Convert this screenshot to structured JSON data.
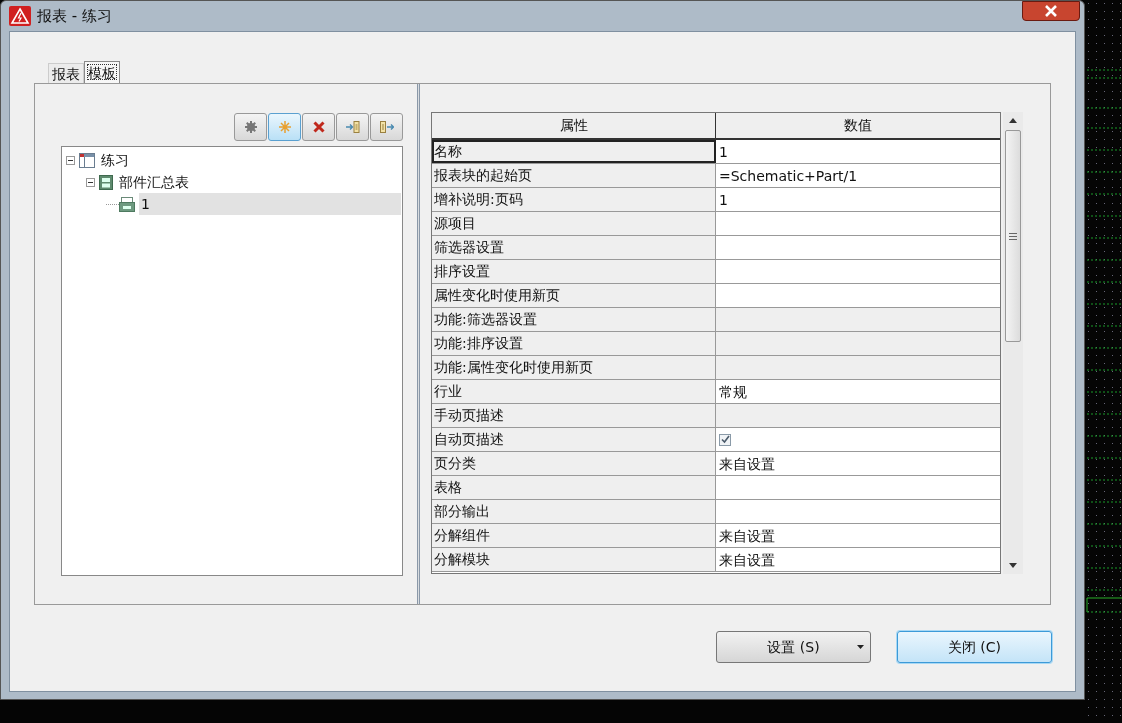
{
  "window": {
    "title": "报表 - 练习"
  },
  "tabs": [
    {
      "label": "报表",
      "selected": false
    },
    {
      "label": "模板",
      "selected": true
    }
  ],
  "toolbar": [
    {
      "kind": "settings",
      "highlighted": false
    },
    {
      "kind": "new",
      "highlighted": true
    },
    {
      "kind": "delete",
      "highlighted": false
    },
    {
      "kind": "import",
      "highlighted": false
    },
    {
      "kind": "export",
      "highlighted": false
    }
  ],
  "tree": [
    {
      "label": "练习",
      "kind": "project",
      "expanded": true,
      "selected": false,
      "children": [
        {
          "label": "部件汇总表",
          "kind": "report",
          "expanded": true,
          "selected": false,
          "children": [
            {
              "label": "1",
              "kind": "template",
              "selected": true
            }
          ]
        }
      ]
    }
  ],
  "grid": {
    "columns": [
      "属性",
      "数值"
    ],
    "rows": [
      {
        "name": "名称",
        "value": "1",
        "kind": "text",
        "editable": true,
        "selected": true
      },
      {
        "name": "报表块的起始页",
        "value": "=Schematic+Part/1",
        "kind": "text",
        "editable": true,
        "selected": false
      },
      {
        "name": "增补说明:页码",
        "value": "1",
        "kind": "text",
        "editable": true,
        "selected": false
      },
      {
        "name": "源项目",
        "kind": "text",
        "editable": true,
        "selected": false
      },
      {
        "name": "筛选器设置",
        "kind": "text",
        "editable": true,
        "selected": false
      },
      {
        "name": "排序设置",
        "kind": "text",
        "editable": true,
        "selected": false
      },
      {
        "name": "属性变化时使用新页",
        "kind": "text",
        "editable": true,
        "selected": false
      },
      {
        "name": "功能:筛选器设置",
        "kind": "text",
        "editable": false,
        "selected": false
      },
      {
        "name": "功能:排序设置",
        "kind": "text",
        "editable": false,
        "selected": false
      },
      {
        "name": "功能:属性变化时使用新页",
        "kind": "text",
        "editable": false,
        "selected": false
      },
      {
        "name": "行业",
        "value": "常规",
        "kind": "text",
        "editable": true,
        "selected": false
      },
      {
        "name": "手动页描述",
        "kind": "text",
        "editable": false,
        "selected": false
      },
      {
        "name": "自动页描述",
        "kind": "checkbox",
        "checked": true,
        "editable": true,
        "selected": false
      },
      {
        "name": "页分类",
        "value": "来自设置",
        "kind": "text",
        "editable": true,
        "selected": false
      },
      {
        "name": "表格",
        "kind": "text",
        "editable": true,
        "selected": false
      },
      {
        "name": "部分输出",
        "kind": "text",
        "editable": true,
        "selected": false
      },
      {
        "name": "分解组件",
        "value": "来自设置",
        "kind": "text",
        "editable": true,
        "selected": false
      },
      {
        "name": "分解模块",
        "value": "来自设置",
        "kind": "text",
        "editable": true,
        "selected": false
      }
    ]
  },
  "buttons": [
    {
      "label": "设置 (S)",
      "kind": "dropdown",
      "focused": false
    },
    {
      "label": "关闭 (C)",
      "kind": "plain",
      "focused": true
    }
  ]
}
